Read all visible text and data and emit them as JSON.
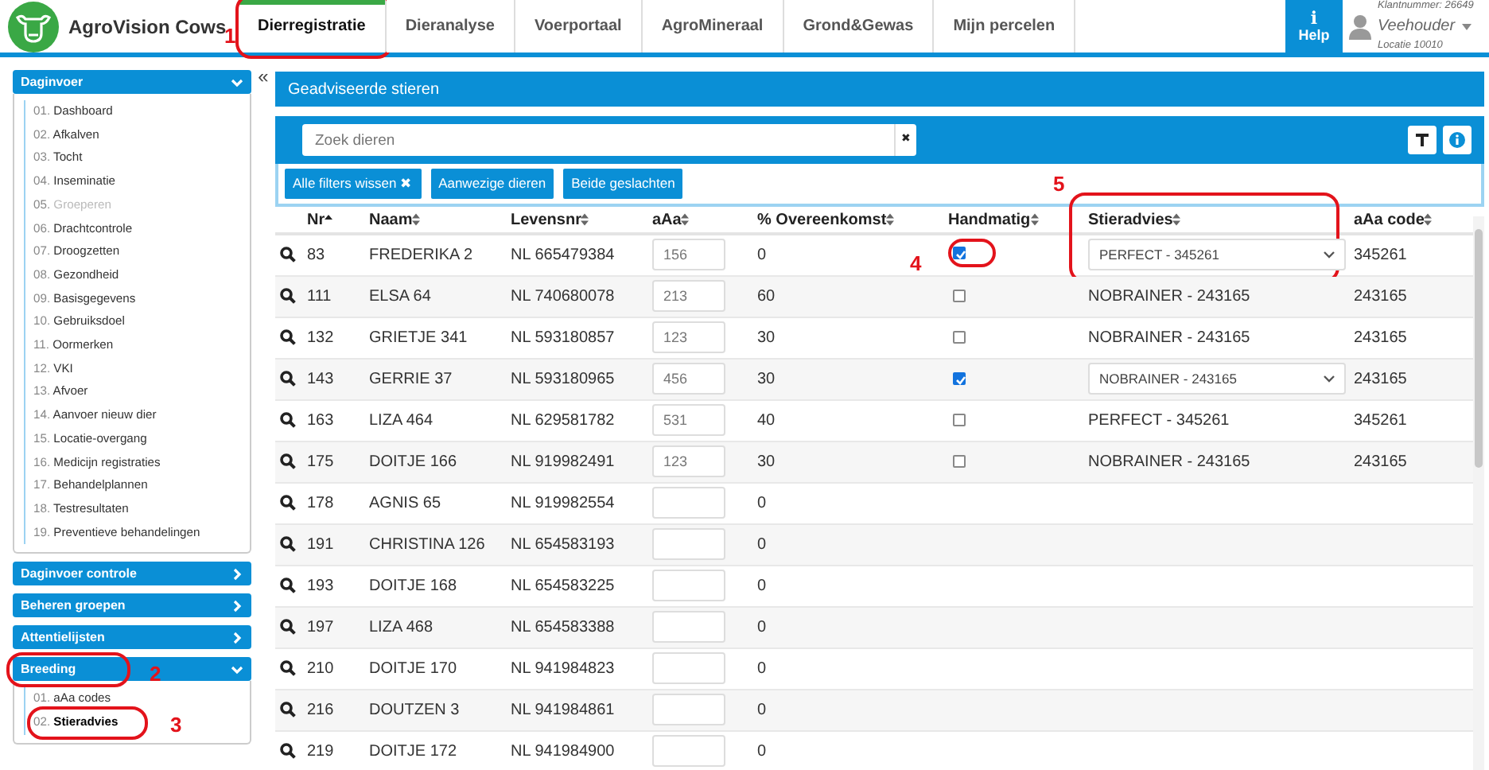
{
  "brand": {
    "name": "AgroVision Cows"
  },
  "tabs": [
    {
      "label": "Dierregistratie",
      "selected": true,
      "callout": "1"
    },
    {
      "label": "Dieranalyse",
      "selected": false
    },
    {
      "label": "Voerportaal",
      "selected": false
    },
    {
      "label": "AgroMineraal",
      "selected": false
    },
    {
      "label": "Grond&Gewas",
      "selected": false
    },
    {
      "label": "Mijn percelen",
      "selected": false
    }
  ],
  "help": {
    "glyph": "i",
    "label": "Help"
  },
  "user": {
    "customer": "Klantnummer: 26649",
    "role": "Veehouder",
    "location": "Locatie 10010"
  },
  "sidebar": {
    "collapse_glyph": "«",
    "sections": [
      {
        "title": "Daginvoer",
        "expanded": true,
        "items": [
          {
            "num": "01.",
            "label": "Dashboard",
            "disabled": false,
            "selected": false
          },
          {
            "num": "02.",
            "label": "Afkalven",
            "disabled": false,
            "selected": false
          },
          {
            "num": "03.",
            "label": "Tocht",
            "disabled": false,
            "selected": false
          },
          {
            "num": "04.",
            "label": "Inseminatie",
            "disabled": false,
            "selected": false
          },
          {
            "num": "05.",
            "label": "Groeperen",
            "disabled": true,
            "selected": false
          },
          {
            "num": "06.",
            "label": "Drachtcontrole",
            "disabled": false,
            "selected": false
          },
          {
            "num": "07.",
            "label": "Droogzetten",
            "disabled": false,
            "selected": false
          },
          {
            "num": "08.",
            "label": "Gezondheid",
            "disabled": false,
            "selected": false
          },
          {
            "num": "09.",
            "label": "Basisgegevens",
            "disabled": false,
            "selected": false
          },
          {
            "num": "10.",
            "label": "Gebruiksdoel",
            "disabled": false,
            "selected": false
          },
          {
            "num": "11.",
            "label": "Oormerken",
            "disabled": false,
            "selected": false
          },
          {
            "num": "12.",
            "label": "VKI",
            "disabled": false,
            "selected": false
          },
          {
            "num": "13.",
            "label": "Afvoer",
            "disabled": false,
            "selected": false
          },
          {
            "num": "14.",
            "label": "Aanvoer nieuw dier",
            "disabled": false,
            "selected": false
          },
          {
            "num": "15.",
            "label": "Locatie-overgang",
            "disabled": false,
            "selected": false
          },
          {
            "num": "16.",
            "label": "Medicijn registraties",
            "disabled": false,
            "selected": false
          },
          {
            "num": "17.",
            "label": "Behandelplannen",
            "disabled": false,
            "selected": false
          },
          {
            "num": "18.",
            "label": "Testresultaten",
            "disabled": false,
            "selected": false
          },
          {
            "num": "19.",
            "label": "Preventieve behandelingen",
            "disabled": false,
            "selected": false
          }
        ]
      },
      {
        "title": "Daginvoer controle",
        "expanded": false
      },
      {
        "title": "Beheren groepen",
        "expanded": false
      },
      {
        "title": "Attentielijsten",
        "expanded": false
      },
      {
        "title": "Breeding",
        "expanded": true,
        "callout": "2",
        "items": [
          {
            "num": "01.",
            "label": "aAa codes",
            "disabled": false,
            "selected": false
          },
          {
            "num": "02.",
            "label": "Stieradvies",
            "disabled": false,
            "selected": true,
            "callout": "3"
          }
        ]
      }
    ]
  },
  "panel": {
    "title": "Geadviseerde stieren",
    "search": {
      "placeholder": "Zoek dieren",
      "clear_glyph": "✖"
    },
    "filters": [
      {
        "label": "Alle filters wissen",
        "clear_glyph": "✖"
      },
      {
        "label": "Aanwezige dieren"
      },
      {
        "label": "Beide geslachten"
      }
    ]
  },
  "table": {
    "columns": [
      {
        "label": "Nr",
        "sorted": true
      },
      {
        "label": "Naam",
        "sorted": false
      },
      {
        "label": "Levensnr",
        "sorted": false
      },
      {
        "label": "aAa",
        "sorted": false
      },
      {
        "label": "% Overeenkomst",
        "sorted": false
      },
      {
        "label": "Handmatig",
        "sorted": false
      },
      {
        "label": "Stieradvies",
        "sorted": false,
        "callout": "5"
      },
      {
        "label": "aAa code",
        "sorted": false
      }
    ],
    "rows": [
      {
        "nr": "83",
        "naam": "FREDERIKA 2",
        "levensnr": "NL 665479384",
        "aaa": "156",
        "overeenkomst": "0",
        "handmatig": {
          "checked": true,
          "callout": "4"
        },
        "stieradvies": {
          "kind": "select",
          "value": "PERFECT - 345261"
        },
        "aaa_code": "345261"
      },
      {
        "nr": "111",
        "naam": "ELSA 64",
        "levensnr": "NL 740680078",
        "aaa": "213",
        "overeenkomst": "60",
        "handmatig": {
          "checked": false
        },
        "stieradvies": {
          "kind": "text",
          "value": "NOBRAINER - 243165"
        },
        "aaa_code": "243165"
      },
      {
        "nr": "132",
        "naam": "GRIETJE 341",
        "levensnr": "NL 593180857",
        "aaa": "123",
        "overeenkomst": "30",
        "handmatig": {
          "checked": false
        },
        "stieradvies": {
          "kind": "text",
          "value": "NOBRAINER - 243165"
        },
        "aaa_code": "243165"
      },
      {
        "nr": "143",
        "naam": "GERRIE 37",
        "levensnr": "NL 593180965",
        "aaa": "456",
        "overeenkomst": "30",
        "handmatig": {
          "checked": true
        },
        "stieradvies": {
          "kind": "select",
          "value": "NOBRAINER - 243165"
        },
        "aaa_code": "243165"
      },
      {
        "nr": "163",
        "naam": "LIZA 464",
        "levensnr": "NL 629581782",
        "aaa": "531",
        "overeenkomst": "40",
        "handmatig": {
          "checked": false
        },
        "stieradvies": {
          "kind": "text",
          "value": "PERFECT - 345261"
        },
        "aaa_code": "345261"
      },
      {
        "nr": "175",
        "naam": "DOITJE 166",
        "levensnr": "NL 919982491",
        "aaa": "123",
        "overeenkomst": "30",
        "handmatig": {
          "checked": false
        },
        "stieradvies": {
          "kind": "text",
          "value": "NOBRAINER - 243165"
        },
        "aaa_code": "243165"
      },
      {
        "nr": "178",
        "naam": "AGNIS 65",
        "levensnr": "NL 919982554",
        "overeenkomst": "0"
      },
      {
        "nr": "191",
        "naam": "CHRISTINA 126",
        "levensnr": "NL 654583193",
        "overeenkomst": "0"
      },
      {
        "nr": "193",
        "naam": "DOITJE 168",
        "levensnr": "NL 654583225",
        "overeenkomst": "0"
      },
      {
        "nr": "197",
        "naam": "LIZA 468",
        "levensnr": "NL 654583388",
        "overeenkomst": "0"
      },
      {
        "nr": "210",
        "naam": "DOITJE 170",
        "levensnr": "NL 941984823",
        "overeenkomst": "0"
      },
      {
        "nr": "216",
        "naam": "DOUTZEN 3",
        "levensnr": "NL 941984861",
        "overeenkomst": "0"
      },
      {
        "nr": "219",
        "naam": "DOITJE 172",
        "levensnr": "NL 941984900",
        "overeenkomst": "0"
      }
    ]
  }
}
